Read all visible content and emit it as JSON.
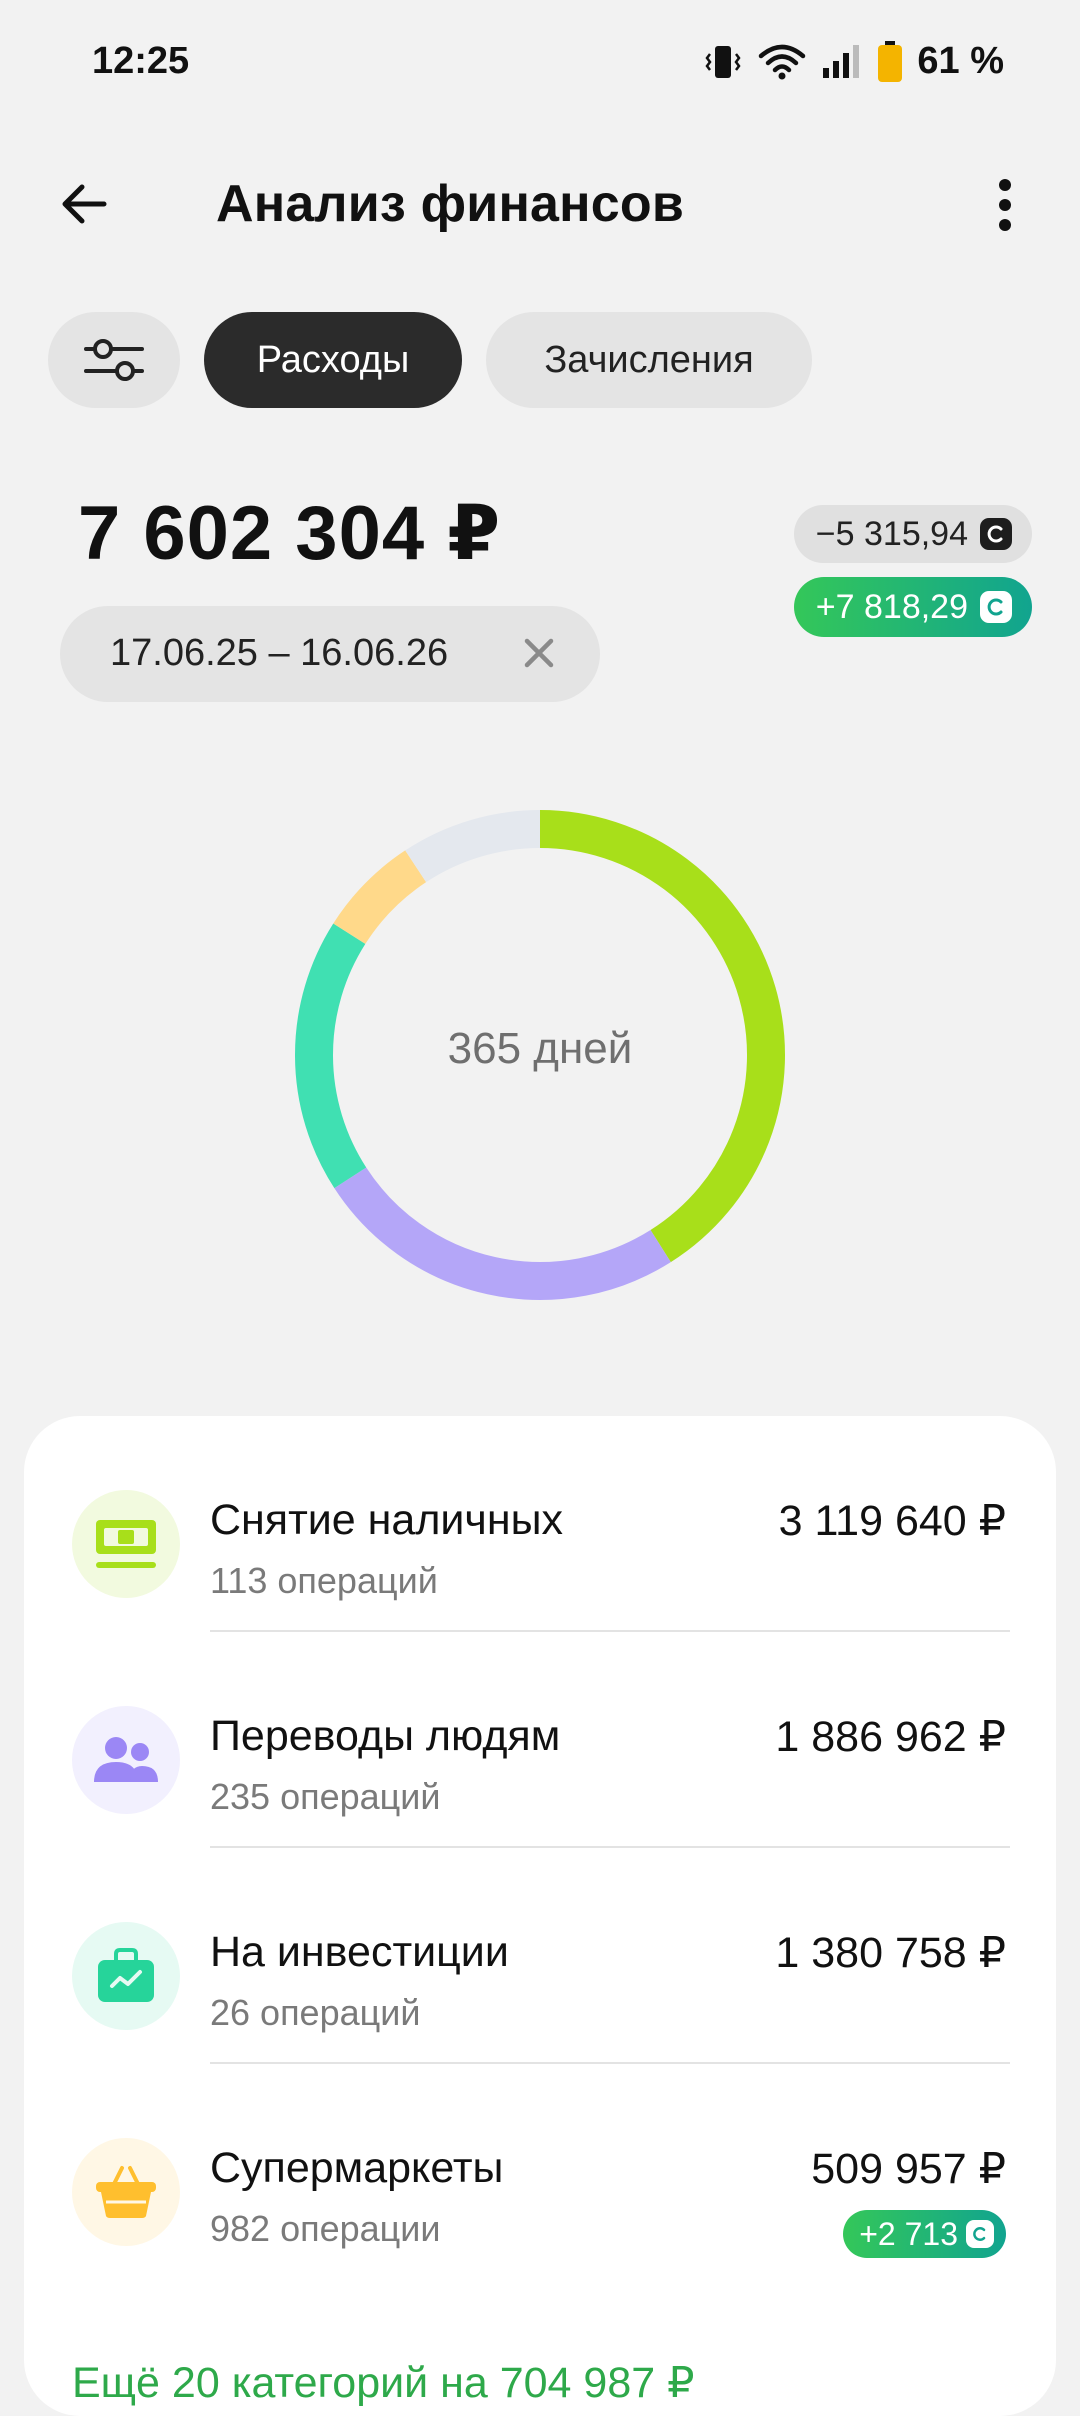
{
  "status_bar": {
    "time": "12:25",
    "battery_text": "61 %",
    "icons": [
      "vibrate-icon",
      "wifi-icon",
      "signal-icon",
      "battery-icon"
    ]
  },
  "header": {
    "title": "Анализ финансов",
    "back_icon": "arrow-left-icon",
    "menu_icon": "more-vertical-icon"
  },
  "chips": {
    "filter_icon": "sliders-icon",
    "expenses": "Расходы",
    "income": "Зачисления",
    "selected": "Расходы"
  },
  "summary": {
    "total": "7 602 304 ₽",
    "date_range": "17.06.25 – 16.06.26",
    "bonus_spent": "−5 315,94",
    "bonus_earned": "+7 818,29"
  },
  "chart_data": {
    "type": "pie",
    "center_label": "365 дней",
    "slices": [
      {
        "label": "Снятие наличных",
        "value": 3119640,
        "color": "#a8df1a"
      },
      {
        "label": "Переводы людям",
        "value": 1886962,
        "color": "#b4a6f8"
      },
      {
        "label": "На инвестиции",
        "value": 1380758,
        "color": "#40e0b2"
      },
      {
        "label": "Супермаркеты",
        "value": 509957,
        "color": "#ffd98a"
      },
      {
        "label": "Ещё 20 категорий",
        "value": 704987,
        "color": "#e4e8ee"
      }
    ]
  },
  "categories": [
    {
      "name": "Снятие наличных",
      "count": "113 операций",
      "amount": "3 119 640 ₽",
      "icon": "cash-icon",
      "color": "#a8df1a",
      "bg": "#f2fadf"
    },
    {
      "name": "Переводы людям",
      "count": "235 операций",
      "amount": "1 886 962 ₽",
      "icon": "people-icon",
      "color": "#9b87f5",
      "bg": "#f2f0fe"
    },
    {
      "name": "На инвестиции",
      "count": "26 операций",
      "amount": "1 380 758 ₽",
      "icon": "briefcase-icon",
      "color": "#26d49a",
      "bg": "#e6faf3"
    },
    {
      "name": "Супермаркеты",
      "count": "982 операции",
      "amount": "509 957 ₽",
      "bonus": "+2 713",
      "icon": "basket-icon",
      "color": "#ffbf2e",
      "bg": "#fff7e5"
    }
  ],
  "more_link": "Ещё 20 категорий на 704 987 ₽"
}
